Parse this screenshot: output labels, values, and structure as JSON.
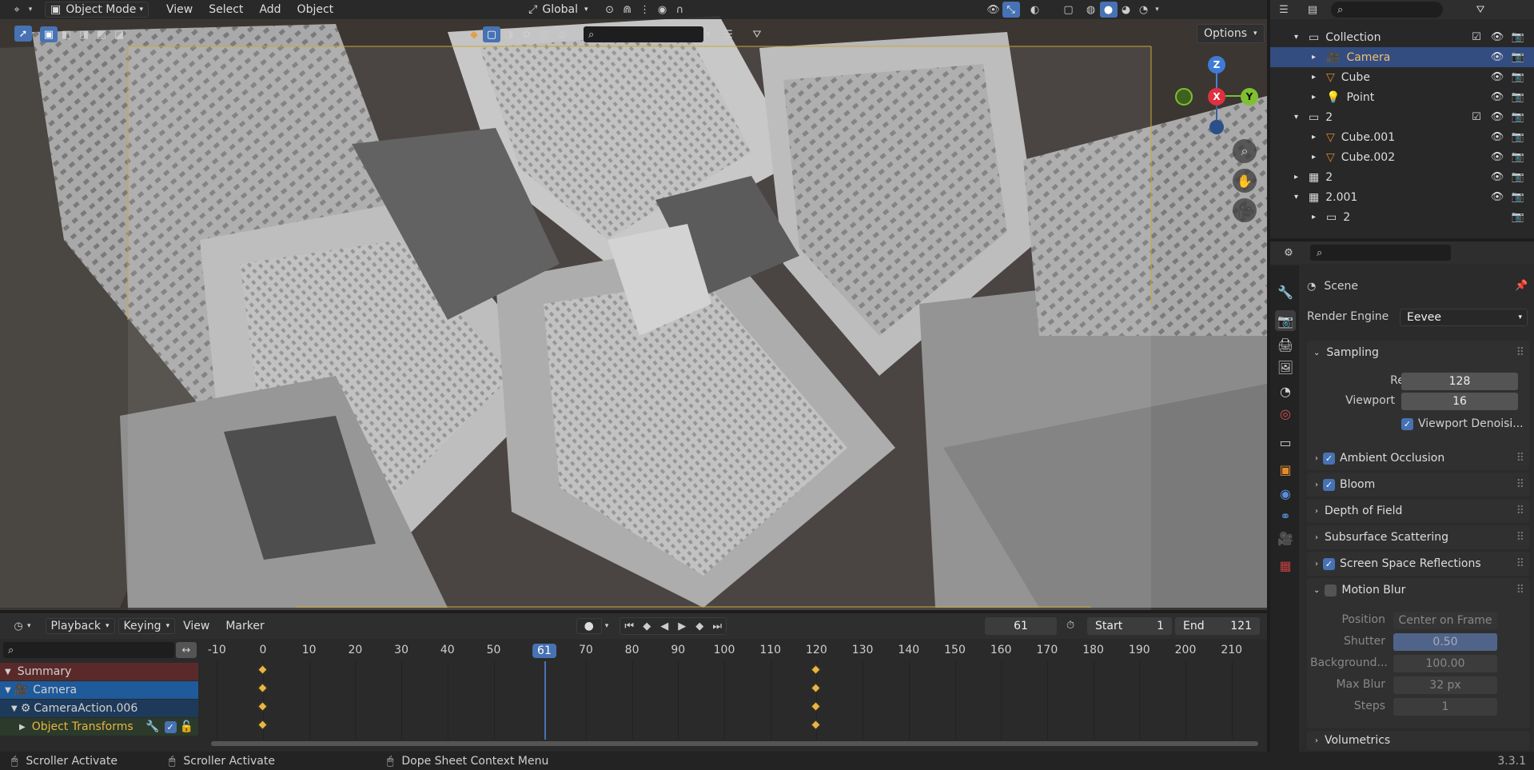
{
  "viewport": {
    "mode_label": "Object Mode",
    "menus": [
      "View",
      "Select",
      "Add",
      "Object"
    ],
    "transform_orientation": "Global",
    "options_label": "Options",
    "gizmo": {
      "x": "X",
      "y": "Y",
      "z": "Z"
    }
  },
  "outliner": {
    "rows": [
      {
        "label": "Collection",
        "depth": 1,
        "expanded": true,
        "icon": "collection-icon"
      },
      {
        "label": "Camera",
        "depth": 2,
        "expanded": false,
        "icon": "camera-object-icon",
        "selected": true
      },
      {
        "label": "Cube",
        "depth": 2,
        "expanded": false,
        "icon": "mesh-object-icon"
      },
      {
        "label": "Point",
        "depth": 2,
        "expanded": false,
        "icon": "light-object-icon"
      },
      {
        "label": "2",
        "depth": 1,
        "expanded": true,
        "icon": "collection-icon"
      },
      {
        "label": "Cube.001",
        "depth": 2,
        "expanded": false,
        "icon": "mesh-object-icon"
      },
      {
        "label": "Cube.002",
        "depth": 2,
        "expanded": false,
        "icon": "mesh-object-icon"
      },
      {
        "label": "2",
        "depth": 1,
        "expanded": false,
        "icon": "scene-icon"
      },
      {
        "label": "2.001",
        "depth": 1,
        "expanded": true,
        "icon": "scene-icon"
      },
      {
        "label": "2",
        "depth": 2,
        "expanded": false,
        "icon": "collection-icon"
      }
    ]
  },
  "properties": {
    "context_label": "Scene",
    "render_engine_label": "Render Engine",
    "render_engine_value": "Eevee",
    "sampling": {
      "title": "Sampling",
      "render_label": "Render",
      "render_value": "128",
      "viewport_label": "Viewport",
      "viewport_value": "16",
      "denoise_label": "Viewport Denoisi..."
    },
    "panels": {
      "ao": "Ambient Occlusion",
      "bloom": "Bloom",
      "dof": "Depth of Field",
      "sss": "Subsurface Scattering",
      "ssr": "Screen Space Reflections",
      "motion_blur": "Motion Blur",
      "volumetrics": "Volumetrics"
    },
    "motion_blur": {
      "position_label": "Position",
      "position_value": "Center on Frame",
      "shutter_label": "Shutter",
      "shutter_value": "0.50",
      "background_label": "Background...",
      "background_value": "100.00",
      "max_blur_label": "Max Blur",
      "max_blur_value": "32 px",
      "steps_label": "Steps",
      "steps_value": "1"
    }
  },
  "timeline": {
    "menus": {
      "playback": "Playback",
      "keying": "Keying",
      "view": "View",
      "marker": "Marker"
    },
    "current_frame": "61",
    "start_label": "Start",
    "start_value": "1",
    "end_label": "End",
    "end_value": "121",
    "ticks": [
      "-10",
      "0",
      "10",
      "20",
      "30",
      "40",
      "50",
      "61",
      "70",
      "80",
      "90",
      "100",
      "110",
      "120",
      "130",
      "140",
      "150",
      "160",
      "170",
      "180",
      "190",
      "200",
      "210"
    ],
    "channels": {
      "summary": "Summary",
      "camera": "Camera",
      "action": "CameraAction.006",
      "transforms": "Object Transforms"
    },
    "keyframes": [
      0,
      120
    ]
  },
  "status": {
    "item1": "Scroller Activate",
    "item2": "Scroller Activate",
    "item3": "Dope Sheet Context Menu",
    "version": "3.3.1"
  },
  "colors": {
    "accent": "#4772b3",
    "selected_row": "#334d80",
    "keyframe": "#e8b542",
    "playhead": "#4772b3",
    "summary_row": "#5a2a2a",
    "camera_row": "#1f5a9a"
  }
}
